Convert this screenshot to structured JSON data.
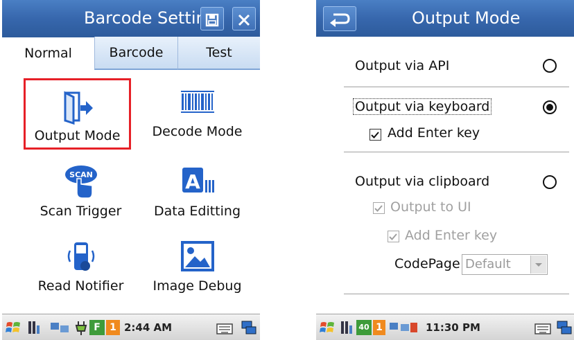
{
  "left": {
    "title": "Barcode Setting",
    "tabs": [
      {
        "label": "Normal",
        "active": true
      },
      {
        "label": "Barcode",
        "active": false
      },
      {
        "label": "Test",
        "active": false
      }
    ],
    "items": [
      {
        "label": "Output Mode",
        "icon": "output-mode-icon",
        "highlighted": true
      },
      {
        "label": "Decode Mode",
        "icon": "barcode-icon"
      },
      {
        "label": "Scan Trigger",
        "icon": "scan-trigger-icon"
      },
      {
        "label": "Data Editting",
        "icon": "data-editing-icon"
      },
      {
        "label": "Read Notifier",
        "icon": "read-notifier-icon"
      },
      {
        "label": "Image Debug",
        "icon": "image-icon"
      }
    ],
    "taskbar": {
      "clock": "2:44 AM",
      "badge_f": "F",
      "badge_1": "1"
    }
  },
  "right": {
    "title": "Output Mode",
    "options": {
      "api": {
        "label": "Output via API",
        "selected": false
      },
      "keyboard": {
        "label": "Output via keyboard",
        "selected": true
      },
      "keyboard_enter": {
        "label": "Add Enter key",
        "checked": true
      },
      "clipboard": {
        "label": "Output via clipboard",
        "selected": false
      },
      "clipboard_ui": {
        "label": "Output to UI",
        "checked": true,
        "enabled": false
      },
      "clipboard_enter": {
        "label": "Add Enter key",
        "checked": true,
        "enabled": false
      },
      "codepage_label": "CodePage",
      "codepage_value": "Default"
    },
    "taskbar": {
      "clock": "11:30 PM",
      "badge_40": "40",
      "badge_1": "1"
    }
  },
  "colors": {
    "titlebar": "#3767ad",
    "icon_blue": "#2463c9",
    "highlight": "#e62027"
  }
}
